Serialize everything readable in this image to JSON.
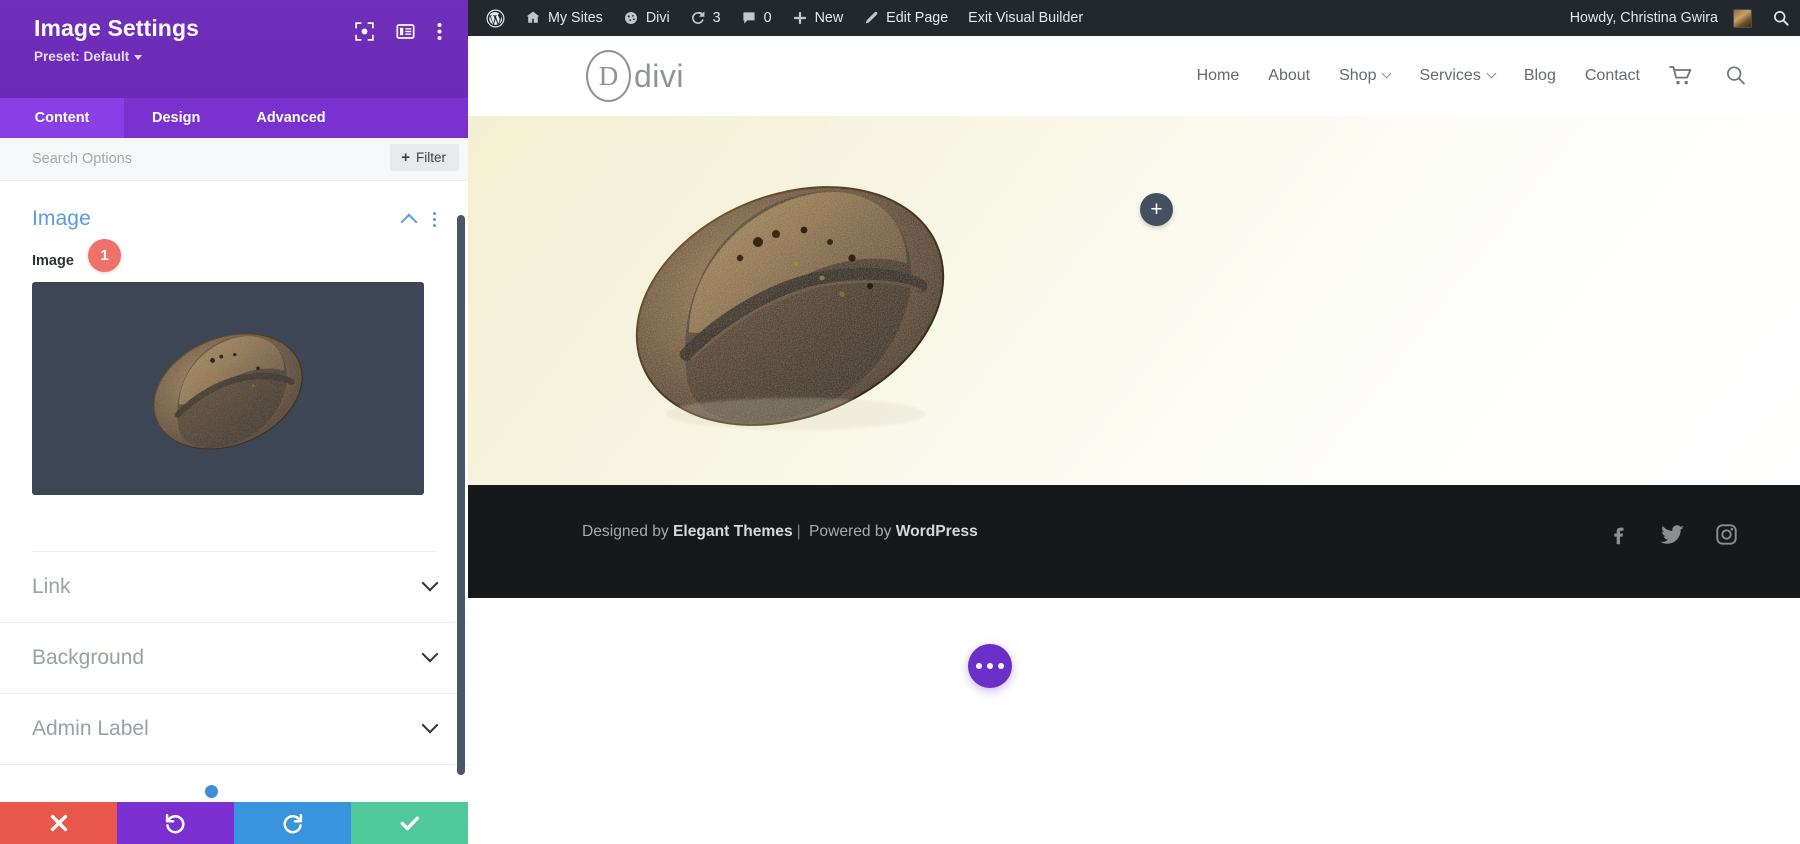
{
  "settings_panel": {
    "title": "Image Settings",
    "preset_label": "Preset: Default",
    "header_icons": [
      {
        "name": "focus-mode-icon",
        "label": "Focus Mode"
      },
      {
        "name": "panel-layout-icon",
        "label": "Panel Layout"
      },
      {
        "name": "more-options-icon",
        "label": "More Options"
      }
    ],
    "tabs": [
      {
        "label": "Content",
        "active": true
      },
      {
        "label": "Design",
        "active": false
      },
      {
        "label": "Advanced",
        "active": false
      }
    ],
    "search": {
      "placeholder": "Search Options",
      "value": ""
    },
    "filter_button": "Filter",
    "open_section": {
      "title": "Image",
      "field_label": "Image",
      "badge": "1"
    },
    "closed_sections": [
      {
        "title": "Link"
      },
      {
        "title": "Background"
      },
      {
        "title": "Admin Label"
      }
    ],
    "footer_buttons": [
      {
        "name": "cancel",
        "glyph": "✖",
        "color": "#e8574b"
      },
      {
        "name": "undo",
        "glyph": "↺",
        "color": "#7b2fd1"
      },
      {
        "name": "redo",
        "glyph": "↻",
        "color": "#3894dd"
      },
      {
        "name": "save",
        "glyph": "✔",
        "color": "#4fc99c"
      }
    ]
  },
  "admin_bar": {
    "items": [
      {
        "label": "",
        "icon": "wordpress-logo-icon"
      },
      {
        "label": "My Sites",
        "icon": "sites-icon"
      },
      {
        "label": "Divi",
        "icon": "divi-icon"
      },
      {
        "label": "3",
        "icon": "updates-icon"
      },
      {
        "label": "0",
        "icon": "comments-icon"
      },
      {
        "label": "New",
        "icon": "plus-icon"
      },
      {
        "label": "Edit Page",
        "icon": "pencil-icon"
      },
      {
        "label": "Exit Visual Builder",
        "icon": ""
      }
    ],
    "howdy": "Howdy, Christina Gwira",
    "search_icon": "search-icon"
  },
  "site": {
    "logo_letter": "D",
    "logo_word": "divi",
    "nav": [
      {
        "label": "Home",
        "dropdown": false
      },
      {
        "label": "About",
        "dropdown": false
      },
      {
        "label": "Shop",
        "dropdown": true
      },
      {
        "label": "Services",
        "dropdown": true
      },
      {
        "label": "Blog",
        "dropdown": false
      },
      {
        "label": "Contact",
        "dropdown": false
      }
    ],
    "cart_icon": "cart-icon",
    "search_icon": "search-icon",
    "add_module_button": "+",
    "footer": {
      "credit_prefix": "Designed by ",
      "credit_brand": "Elegant Themes",
      "credit_sep": "|",
      "credit_middle": " Powered by ",
      "credit_platform": "WordPress",
      "socials": [
        "facebook-icon",
        "twitter-icon",
        "instagram-icon"
      ]
    }
  },
  "colors": {
    "panel_purple": "#6c2eb7",
    "tab_active": "#8a3ee6",
    "section_blue": "#5b9ae2",
    "badge_red": "#f0706a",
    "save_green": "#4fc99c",
    "fab_purple": "#6a2fc9",
    "adminbar_dark": "#23282d"
  }
}
